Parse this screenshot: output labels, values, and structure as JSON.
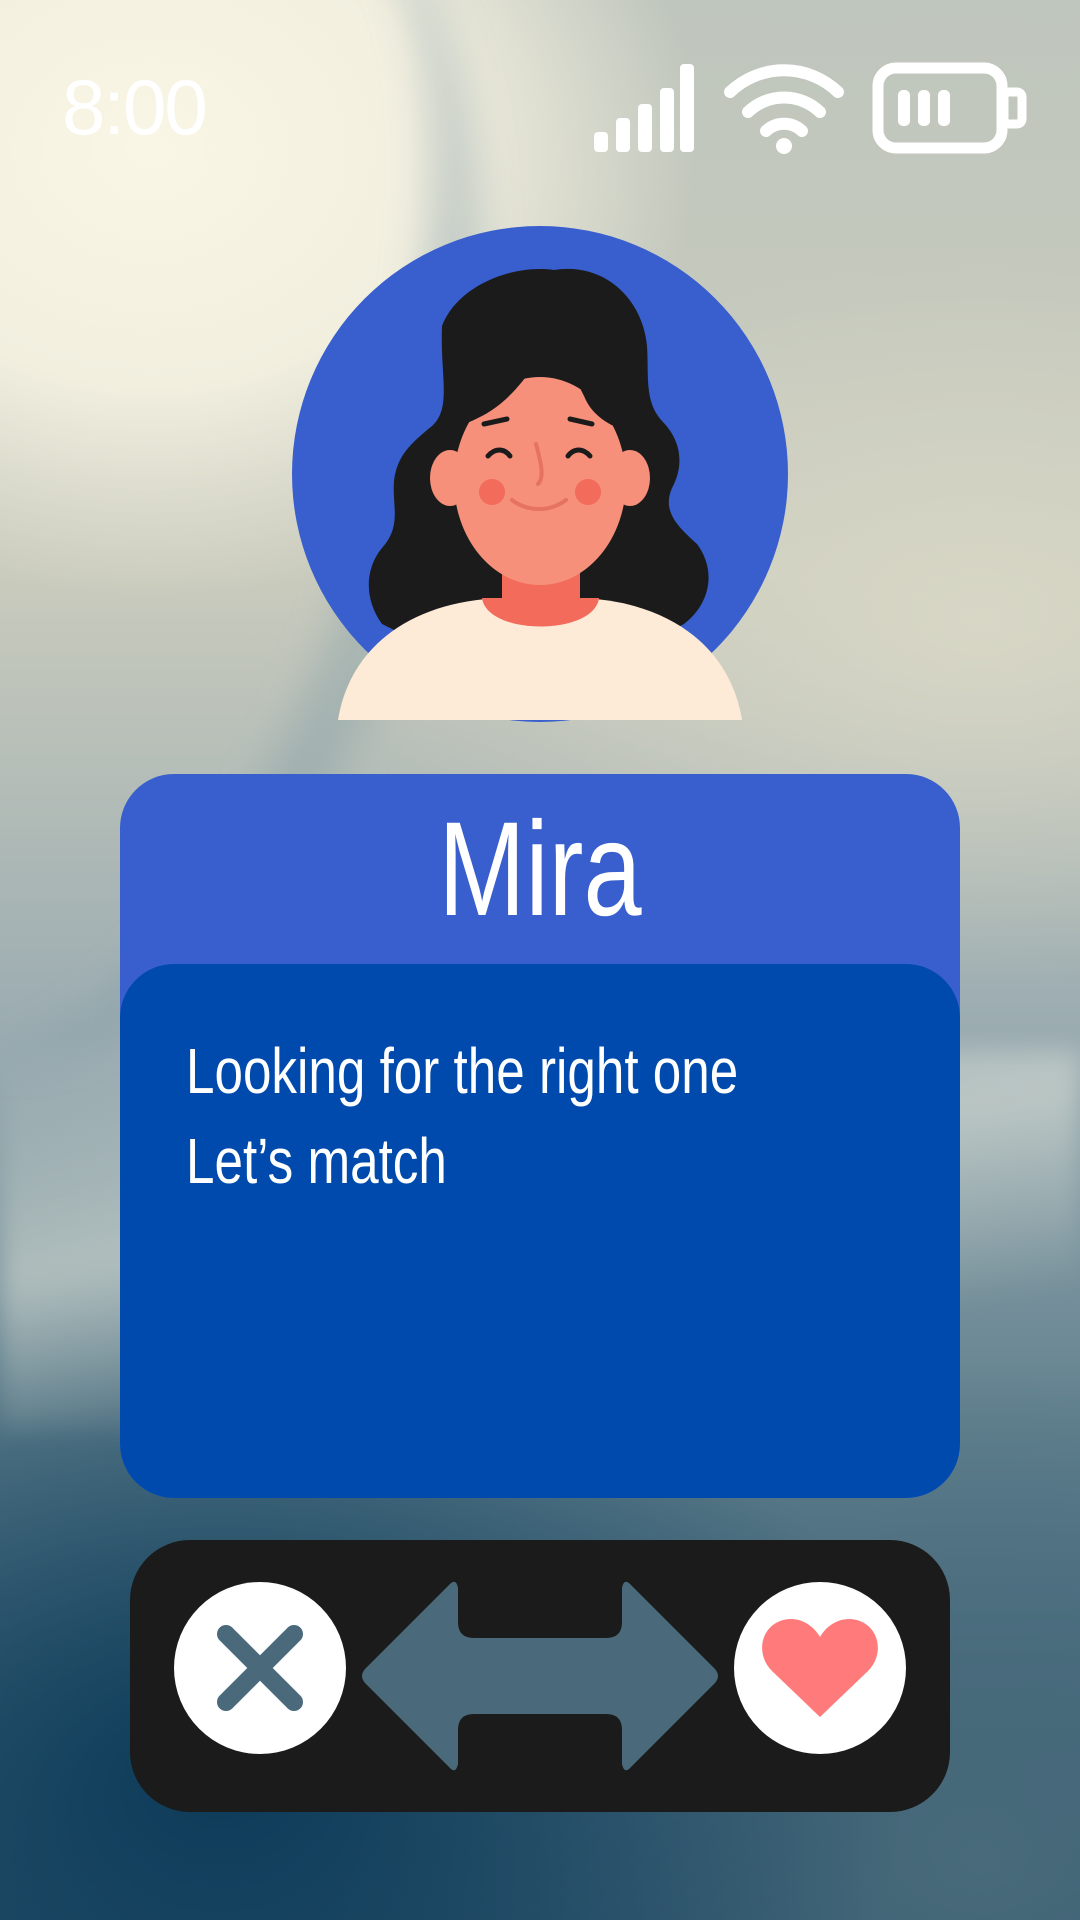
{
  "status_bar": {
    "time": "8:00",
    "icons": [
      "signal-icon",
      "wifi-icon",
      "battery-icon"
    ]
  },
  "profile": {
    "name": "Mira",
    "bio": [
      "Looking for the right one",
      "Let’s match"
    ]
  },
  "actions": {
    "reject_icon": "close-icon",
    "swipe_icon": "double-arrow-icon",
    "like_icon": "heart-icon"
  },
  "colors": {
    "card_header": "#385fcd",
    "card_body": "#004aad",
    "action_bar": "#1b1b1b",
    "accent_heart": "#ff7a7a",
    "icon_muted": "#4a6a7c"
  }
}
